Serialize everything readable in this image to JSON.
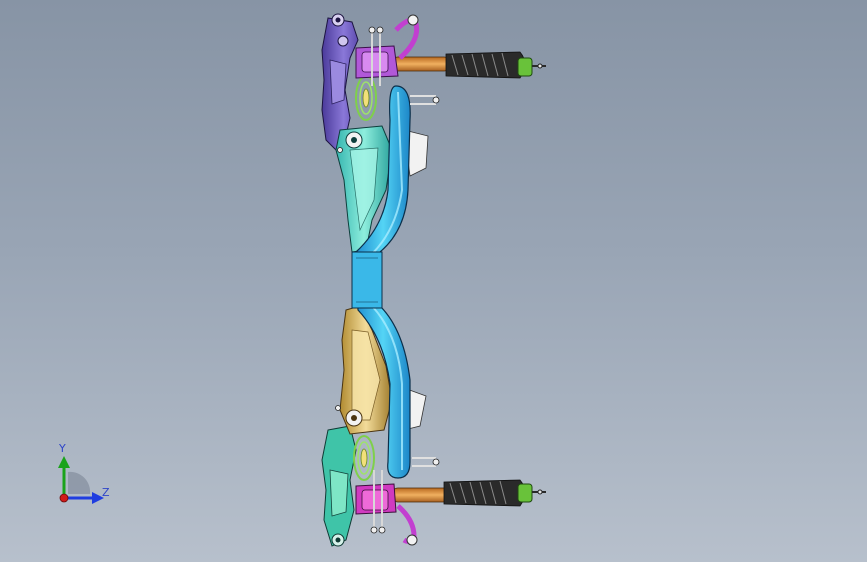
{
  "viewport": {
    "background_top": "#8794a5",
    "background_bottom": "#b7c0cc"
  },
  "model": {
    "colors": {
      "beam": "#2fb7e6",
      "beam_outline": "#0b2f4a",
      "left_arm": "#61dcc9",
      "right_arm": "#d8b86a",
      "knuckle_upper": "#7a64c8",
      "knuckle_lower": "#40c8a8",
      "mount": "#d04ad0",
      "tie_rod": "#d39236",
      "boot": "#2a2a2a",
      "spring": "#98dd5a",
      "bolt": "#e6e6e6"
    }
  },
  "triad": {
    "y_label": "Y",
    "z_label": "Z",
    "y_axis_color": "#1aa31a",
    "z_axis_color": "#1f3de0",
    "origin_color": "#d01a1a"
  }
}
